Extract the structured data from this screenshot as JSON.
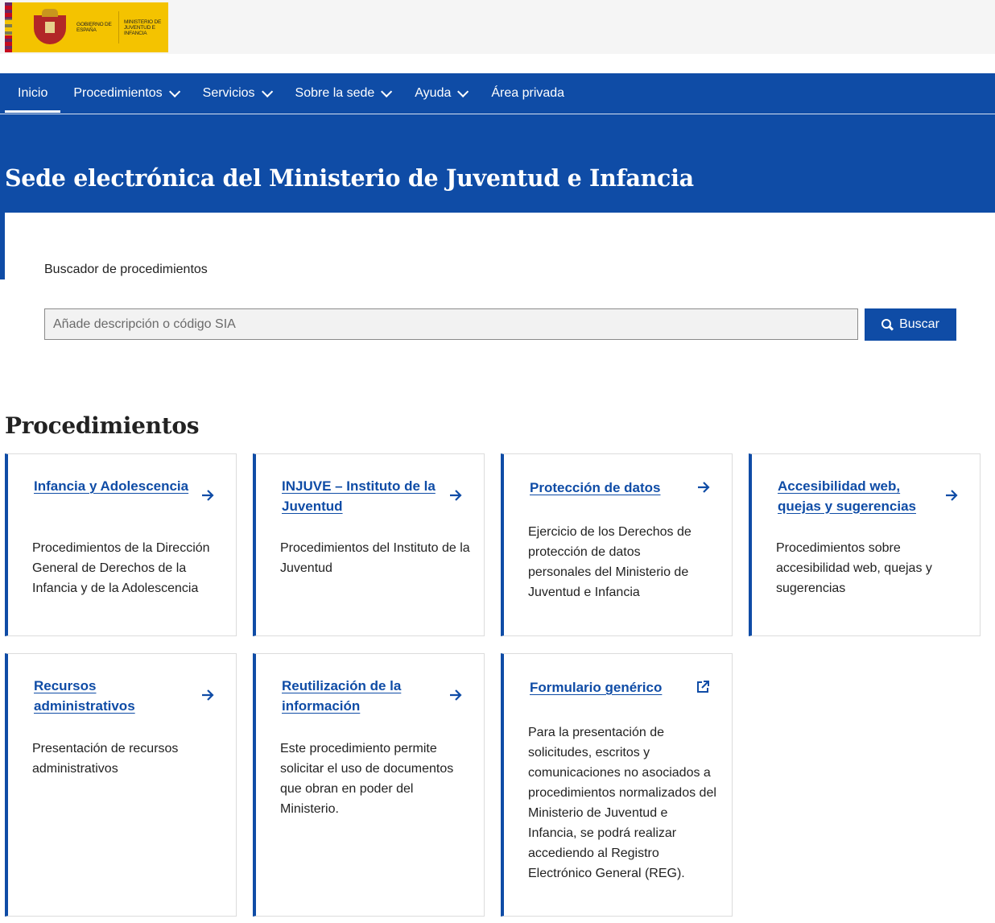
{
  "header": {
    "logo_text_1": "GOBIERNO DE ESPAÑA",
    "logo_text_2": "MINISTERIO DE JUVENTUD E INFANCIA"
  },
  "nav": {
    "items": [
      {
        "label": "Inicio"
      },
      {
        "label": "Procedimientos"
      },
      {
        "label": "Servicios"
      },
      {
        "label": "Sobre la sede"
      },
      {
        "label": "Ayuda"
      },
      {
        "label": "Área privada"
      }
    ]
  },
  "hero": {
    "title": "Sede electrónica del Ministerio de Juventud e Infancia"
  },
  "search": {
    "label": "Buscador de procedimientos",
    "placeholder": "Añade descripción o código SIA",
    "value": "",
    "button_label": "Buscar"
  },
  "procedures": {
    "title": "Procedimientos",
    "cards": [
      {
        "title": "Infancia y Adolescencia",
        "description": "Procedimientos de la Dirección General de Derechos de la Infancia y de la Adolescencia",
        "icon": "arrow-right-icon"
      },
      {
        "title": "INJUVE – Instituto de la Juventud",
        "description": "Procedimientos del Instituto de la Juventud",
        "icon": "arrow-right-icon"
      },
      {
        "title": "Protección de datos",
        "description": "Ejercicio de los Derechos de protección de datos personales del Ministerio de Juventud e Infancia",
        "icon": "arrow-right-icon"
      },
      {
        "title": "Accesibilidad web, quejas y sugerencias",
        "description": "Procedimientos sobre accesibilidad web, quejas y sugerencias",
        "icon": "arrow-right-icon"
      },
      {
        "title": "Recursos administrativos",
        "description": "Presentación de recursos administrativos",
        "icon": "arrow-right-icon"
      },
      {
        "title": "Reutilización de la información",
        "description": "Este procedimiento permite solicitar el uso de documentos que obran en poder del Ministerio.",
        "icon": "arrow-right-icon"
      },
      {
        "title": "Formulario genérico",
        "description": "Para la presentación de solicitudes, escritos y comunicaciones no asociados a procedimientos normalizados del Ministerio de Juventud e Infancia, se podrá realizar accediendo al Registro Electrónico General (REG).",
        "icon": "external-link-icon"
      }
    ]
  },
  "colors": {
    "primary": "#0f4ca6",
    "logo_yellow": "#f4c300"
  }
}
